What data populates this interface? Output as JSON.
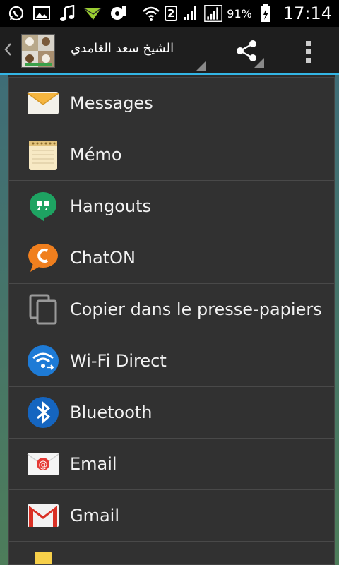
{
  "status_bar": {
    "icons": [
      "whatsapp-icon",
      "gallery-icon",
      "music-note-icon",
      "send-icon",
      "disc-icon",
      "wifi-icon",
      "sim-2-icon",
      "signal-icon",
      "signal-full-icon",
      "battery-icon"
    ],
    "sim_label": "2",
    "battery_percent": "91%",
    "time": "17:14"
  },
  "action_bar": {
    "title": "الشيخ سعد الغامدي",
    "accent_color": "#33b5e5"
  },
  "share_menu": {
    "items": [
      {
        "label": "Messages",
        "icon": "messages-icon"
      },
      {
        "label": "Mémo",
        "icon": "memo-icon"
      },
      {
        "label": "Hangouts",
        "icon": "hangouts-icon"
      },
      {
        "label": "ChatON",
        "icon": "chaton-icon"
      },
      {
        "label": "Copier dans le presse-papiers",
        "icon": "copy-clipboard-icon"
      },
      {
        "label": "Wi-Fi Direct",
        "icon": "wifi-direct-icon"
      },
      {
        "label": "Bluetooth",
        "icon": "bluetooth-icon"
      },
      {
        "label": "Email",
        "icon": "email-icon"
      },
      {
        "label": "Gmail",
        "icon": "gmail-icon"
      },
      {
        "label": "",
        "icon": "partial-app-icon"
      }
    ]
  }
}
